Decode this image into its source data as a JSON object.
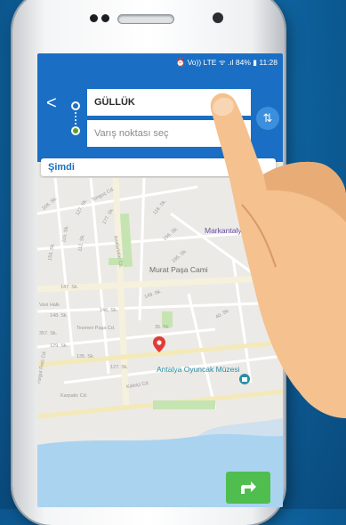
{
  "status_bar": {
    "text": "⏰ Vo)) LTE ᯤ .ıl 84% ▮ 11:28"
  },
  "route": {
    "origin_value": "GÜLLÜK",
    "destination_placeholder": "Varış noktası seç",
    "back_label": "<",
    "swap_label": "⇅"
  },
  "time_selector": {
    "label": "Şimdi"
  },
  "map": {
    "streets": [
      "Tonguç Cd.",
      "127. Sk.",
      "177. Sk.",
      "Anafartalar Cd.",
      "116. Sk.",
      "115. Sk.",
      "112. Sk.",
      "153. Sk.",
      "208. Sk.",
      "166. Sk.",
      "165. Sk.",
      "147. Sk.",
      "149. Sk.",
      "Vavi Halk",
      "148. Sk.",
      "146. Sk.",
      "357. Sk.",
      "Tesmen Paşa Cd.",
      "35. Sk.",
      "129. Sk.",
      "135. Sk.",
      "127. Sk.",
      "40. Sk.",
      "Karpatic Cd.",
      "Turgut Reis Cd.",
      "Kaleiçi Cd."
    ],
    "pois": [
      {
        "name": "Markantalya",
        "color": "#6b4fa8"
      },
      {
        "name": "Murat Paşa Cami",
        "color": "#6d6d6d"
      },
      {
        "name": "Antalya Oyuncak Müzesi",
        "color": "#2a8fa8"
      }
    ]
  },
  "colors": {
    "primary": "#1a6fc4",
    "accent_green": "#4fbe4f",
    "pin_red": "#e23a36"
  },
  "icons": {
    "back": "chevron-left-icon",
    "swap": "swap-vertical-icon",
    "pin": "location-pin-icon",
    "directions": "turn-right-arrow-icon"
  }
}
